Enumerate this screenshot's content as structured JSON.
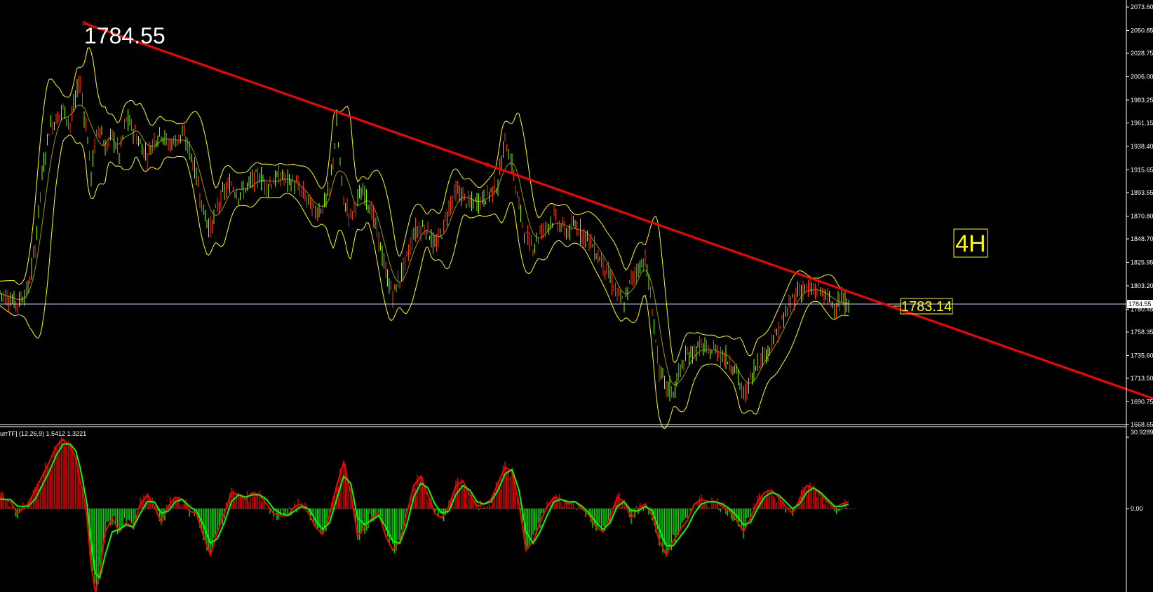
{
  "colors": {
    "background": "#000000",
    "grid_line": "#ffffff",
    "bollinger": "#ffff00",
    "candle_up": "#7fff00",
    "candle_down": "#ff3a00",
    "trendline": "#ff0000",
    "macd_line": "#ff0000",
    "signal_line": "#00ff00",
    "hist_positive": "#ff0000",
    "hist_negative": "#00ff00",
    "price_label": "#ffff00",
    "axis_text": "#ffffff"
  },
  "main": {
    "peak_annotation": "1784.55",
    "timeframe_label": "4H",
    "current_price_tag": "1783.14",
    "horizontal_line_label": "1784.55",
    "y_ticks": [
      "2073.60",
      "2050.85",
      "2028.75",
      "2006.00",
      "1983.25",
      "1961.15",
      "1938.40",
      "1915.65",
      "1893.55",
      "1870.80",
      "1848.70",
      "1825.95",
      "1803.20",
      "1780.45",
      "1758.35",
      "1735.60",
      "1713.50",
      "1690.75",
      "1668.65"
    ]
  },
  "indicator": {
    "title": "urrTF] (12,26,9) 1.5412 1.3221",
    "top_tick": "30.9289",
    "zero_tick": "0.00"
  },
  "chart_data": [
    {
      "type": "line",
      "title": "",
      "ylim": [
        1668.65,
        2073.6
      ],
      "series": [
        {
          "name": "",
          "x": [
            0,
            15,
            25,
            40,
            50,
            60,
            70,
            80,
            90,
            100,
            108,
            114,
            118,
            124,
            130,
            136,
            142,
            150,
            160,
            170,
            180,
            190,
            200,
            210,
            220,
            230,
            240,
            250,
            260,
            270,
            280,
            290,
            300,
            310,
            320,
            330,
            340,
            350,
            360,
            370,
            380,
            390,
            400,
            410,
            420,
            430,
            440,
            450,
            460,
            470,
            480,
            490,
            500,
            510,
            520,
            530,
            540,
            550,
            560,
            570,
            580,
            590,
            600,
            610,
            620,
            630,
            640,
            650,
            660,
            670,
            680,
            690,
            700,
            710,
            720,
            730,
            740,
            750,
            760,
            770,
            780,
            790,
            800,
            810,
            820,
            830,
            840,
            850,
            860,
            870,
            880,
            890,
            900,
            910,
            920,
            930,
            940,
            950,
            960,
            970,
            980,
            990,
            1000,
            1010,
            1020,
            1030,
            1040,
            1050,
            1060,
            1070,
            1080,
            1090,
            1100,
            1110,
            1120,
            1130,
            1140,
            1150,
            1160,
            1170,
            1180,
            1190,
            1200,
            1210
          ],
          "values": [
            1797,
            1790,
            1786,
            1800,
            1840,
            1910,
            1955,
            1965,
            1975,
            1960,
            1985,
            2005,
            1980,
            1952,
            1910,
            1945,
            1960,
            1935,
            1950,
            1930,
            1965,
            1955,
            1940,
            1930,
            1945,
            1952,
            1940,
            1944,
            1950,
            1935,
            1910,
            1875,
            1858,
            1880,
            1895,
            1902,
            1892,
            1898,
            1905,
            1910,
            1900,
            1905,
            1910,
            1905,
            1903,
            1895,
            1885,
            1875,
            1880,
            1895,
            1958,
            1885,
            1870,
            1888,
            1893,
            1875,
            1850,
            1815,
            1795,
            1810,
            1830,
            1855,
            1860,
            1858,
            1840,
            1855,
            1880,
            1895,
            1890,
            1882,
            1885,
            1888,
            1895,
            1902,
            1945,
            1920,
            1880,
            1850,
            1842,
            1855,
            1862,
            1870,
            1860,
            1855,
            1862,
            1855,
            1848,
            1835,
            1825,
            1810,
            1795,
            1785,
            1810,
            1820,
            1830,
            1780,
            1720,
            1705,
            1700,
            1722,
            1735,
            1740,
            1745,
            1738,
            1742,
            1735,
            1730,
            1720,
            1695,
            1712,
            1730,
            1735,
            1748,
            1760,
            1775,
            1790,
            1800,
            1800,
            1798,
            1800,
            1790,
            1785,
            1788,
            1785
          ]
        }
      ],
      "trendline": {
        "x": [
          120,
          1644
        ],
        "y": [
          2058,
          1694
        ]
      }
    },
    {
      "type": "bar",
      "title": "",
      "ylim": [
        -40,
        40
      ],
      "x": [
        0,
        15,
        25,
        40,
        50,
        60,
        70,
        80,
        90,
        100,
        108,
        114,
        118,
        124,
        130,
        136,
        142,
        150,
        160,
        170,
        180,
        190,
        200,
        210,
        220,
        230,
        240,
        250,
        260,
        270,
        280,
        290,
        300,
        310,
        320,
        330,
        340,
        350,
        360,
        370,
        380,
        390,
        400,
        410,
        420,
        430,
        440,
        450,
        460,
        470,
        480,
        490,
        500,
        510,
        520,
        530,
        540,
        550,
        560,
        570,
        580,
        590,
        600,
        610,
        620,
        630,
        640,
        650,
        660,
        670,
        680,
        690,
        700,
        710,
        720,
        730,
        740,
        750,
        760,
        770,
        780,
        790,
        800,
        810,
        820,
        830,
        840,
        850,
        860,
        870,
        880,
        890,
        900,
        910,
        920,
        930,
        940,
        950,
        960,
        970,
        980,
        990,
        1000,
        1010,
        1020,
        1030,
        1040,
        1050,
        1060,
        1070,
        1080,
        1090,
        1100,
        1110,
        1120,
        1130,
        1140,
        1150,
        1160,
        1170,
        1180,
        1190,
        1200,
        1210
      ],
      "series": [
        {
          "name": "",
          "values": [
            5,
            3,
            -2,
            2,
            8,
            14,
            20,
            27,
            30,
            27,
            22,
            12,
            8,
            -4,
            -25,
            -36,
            -28,
            -10,
            -4,
            -10,
            -6,
            -8,
            2,
            6,
            1,
            -6,
            1,
            5,
            4,
            -1,
            -2,
            -12,
            -20,
            -10,
            -2,
            7,
            6,
            4,
            7,
            6,
            2,
            -2,
            -3,
            -3,
            1,
            2,
            -2,
            -8,
            -11,
            -3,
            10,
            20,
            7,
            -12,
            -8,
            -4,
            -2,
            -12,
            -18,
            -14,
            -2,
            10,
            14,
            6,
            -2,
            -4,
            1,
            10,
            12,
            6,
            1,
            2,
            4,
            11,
            18,
            16,
            2,
            -18,
            -14,
            -6,
            1,
            5,
            4,
            2,
            3,
            0,
            -3,
            -8,
            -10,
            -4,
            5,
            3,
            -4,
            0,
            2,
            -3,
            -14,
            -20,
            -14,
            -9,
            -5,
            2,
            4,
            3,
            3,
            1,
            -1,
            -5,
            -10,
            -4,
            3,
            7,
            8,
            5,
            1,
            -2,
            4,
            10,
            9,
            6,
            3,
            0,
            2,
            3
          ]
        },
        {
          "name": "",
          "values": [
            4,
            4,
            1,
            1,
            4,
            10,
            16,
            23,
            28,
            28,
            25,
            18,
            12,
            2,
            -15,
            -28,
            -30,
            -20,
            -10,
            -9,
            -7,
            -8,
            -2,
            3,
            3,
            -2,
            -1,
            3,
            4,
            1,
            -1,
            -7,
            -15,
            -13,
            -6,
            3,
            6,
            5,
            6,
            6,
            4,
            0,
            -2,
            -3,
            -1,
            1,
            0,
            -5,
            -9,
            -6,
            4,
            14,
            11,
            -4,
            -7,
            -5,
            -3,
            -8,
            -14,
            -15,
            -7,
            5,
            11,
            9,
            2,
            -2,
            -1,
            6,
            10,
            8,
            3,
            2,
            3,
            8,
            15,
            17,
            8,
            -10,
            -15,
            -10,
            -3,
            3,
            4,
            3,
            3,
            1,
            -2,
            -6,
            -9,
            -6,
            1,
            3,
            -1,
            -1,
            1,
            -1,
            -9,
            -16,
            -16,
            -12,
            -8,
            -2,
            2,
            3,
            3,
            2,
            0,
            -3,
            -7,
            -6,
            0,
            5,
            7,
            6,
            3,
            0,
            2,
            7,
            9,
            7,
            4,
            1,
            1,
            2
          ]
        }
      ]
    }
  ]
}
